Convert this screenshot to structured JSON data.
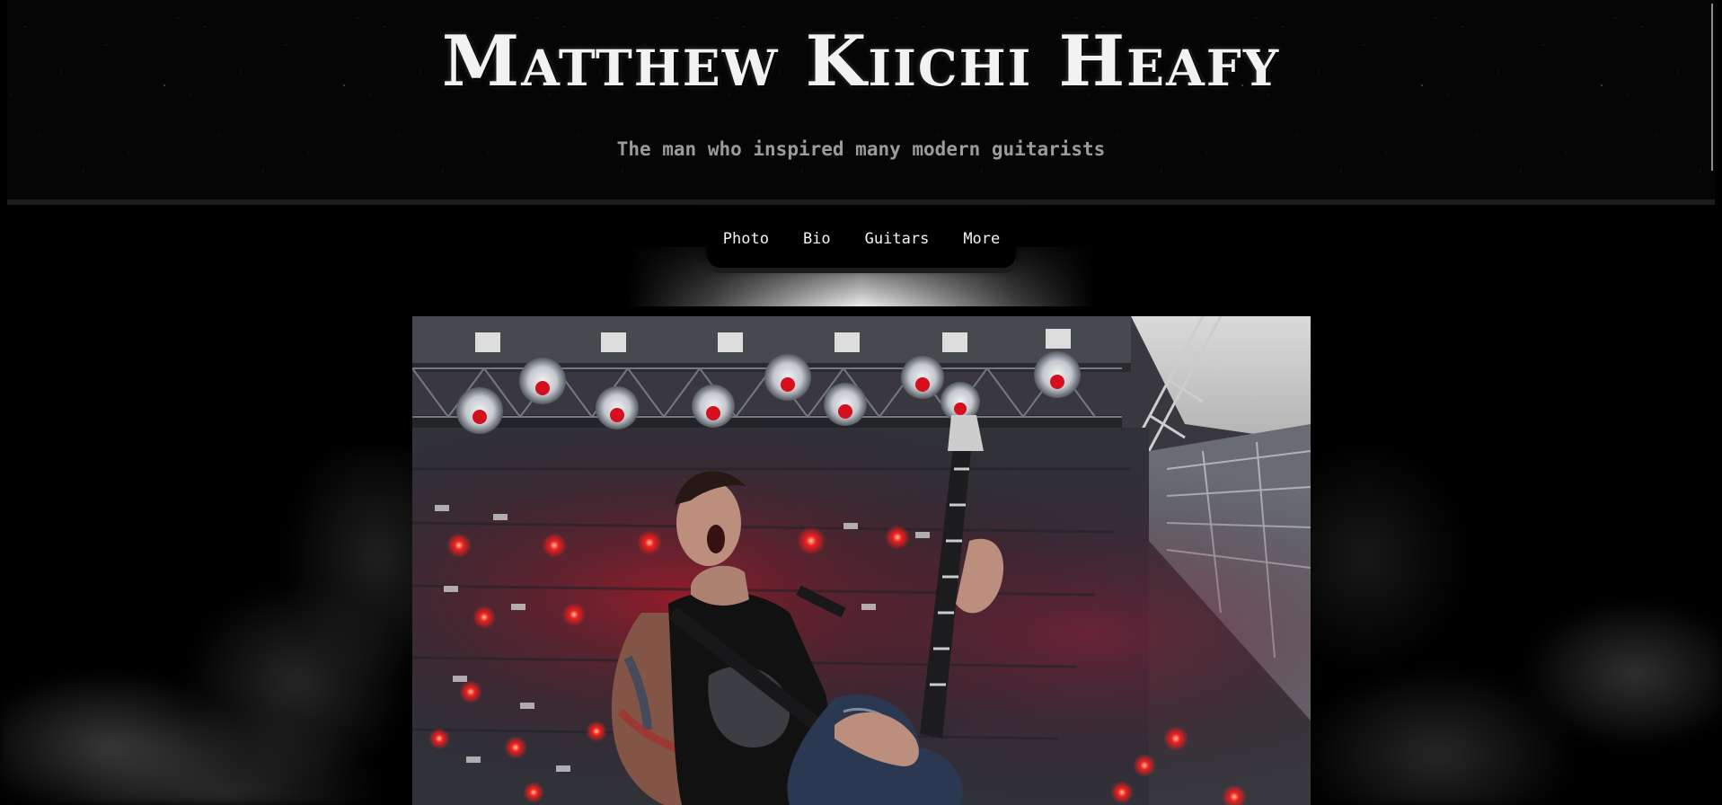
{
  "header": {
    "title": "Matthew Kiichi Heafy",
    "subtitle": "The man who inspired many modern guitarists"
  },
  "nav": {
    "items": [
      {
        "label": "Photo"
      },
      {
        "label": "Bio"
      },
      {
        "label": "Guitars"
      },
      {
        "label": "More"
      }
    ]
  },
  "colors": {
    "background": "#000000",
    "title": "#f2f2f2",
    "subtitle": "#9b9b9b",
    "stage_red": "#e0141e"
  }
}
